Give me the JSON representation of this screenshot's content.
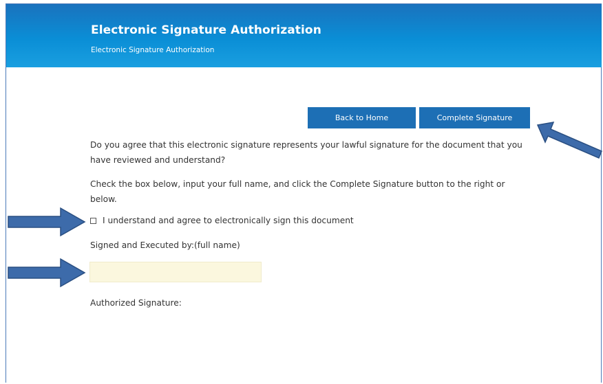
{
  "header": {
    "title": "Electronic Signature Authorization",
    "subtitle": "Electronic Signature Authorization"
  },
  "buttons": {
    "back": "Back to Home",
    "complete": "Complete Signature"
  },
  "content": {
    "question": "Do you agree that this electronic signature represents your lawful signature for the document that you have reviewed and understand?",
    "instructions": "Check the box below, input your full name, and click the Complete Signature button to the right or below.",
    "checkbox_label": "I understand and agree to electronically sign this document",
    "checkbox_checked": false,
    "signed_label": "Signed and Executed by:(full name)",
    "full_name_value": "",
    "full_name_placeholder": "",
    "authorized_label": "Authorized Signature:"
  },
  "colors": {
    "header_start": "#1a72bd",
    "header_end": "#1a9fe0",
    "button": "#1d6fb5",
    "input_bg": "#fbf7de",
    "annotation_arrow": "#3d6baa"
  },
  "icons": [
    "arrow-right-icon",
    "arrow-upleft-icon"
  ]
}
